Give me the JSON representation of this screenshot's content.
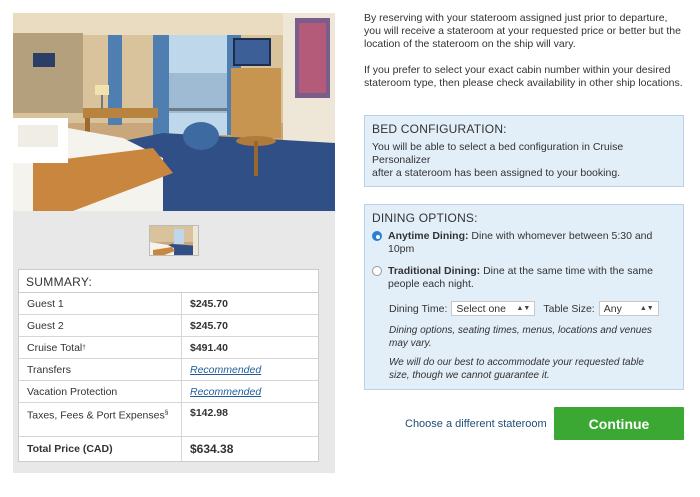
{
  "intro": {
    "paragraph1": "By reserving with your stateroom assigned just prior to departure, you will receive a stateroom at your requested price or better but the location of the stateroom on the ship will vary.",
    "paragraph2": "If you prefer to select your exact cabin number within your desired stateroom type, then please check availability in other ship locations."
  },
  "bed_config": {
    "title": "BED CONFIGURATION:",
    "line1": "You will be able to select a bed configuration in Cruise Personalizer",
    "line2": "after a stateroom has been assigned to your booking."
  },
  "dining": {
    "title": "DINING OPTIONS:",
    "anytime_label": "Anytime Dining:",
    "anytime_desc": "Dine with whomever between 5:30 and 10pm",
    "traditional_label": "Traditional Dining:",
    "traditional_desc": "Dine at the same time with the same people each night.",
    "dining_time_label": "Dining Time:",
    "dining_time_value": "Select one",
    "table_size_label": "Table Size:",
    "table_size_value": "Any",
    "note1": "Dining options, seating times, menus, locations and venues may vary.",
    "note2": "We will do our best to accommodate your requested table size, though we cannot guarantee it."
  },
  "summary": {
    "title": "SUMMARY:",
    "rows": [
      {
        "label": "Guest 1",
        "value": "$245.70"
      },
      {
        "label": "Guest 2",
        "value": "$245.70"
      },
      {
        "label": "Cruise Total",
        "sup": "†",
        "value": "$491.40"
      },
      {
        "label": "Transfers",
        "value": "Recommended"
      },
      {
        "label": "Vacation Protection",
        "value": "Recommended"
      },
      {
        "label": "Taxes, Fees & Port Expenses",
        "sup": "§",
        "value": "$142.98"
      },
      {
        "label": "Total Price (CAD)",
        "value": "$634.38"
      }
    ]
  },
  "actions": {
    "change_stateroom": "Choose a different stateroom",
    "continue": "Continue"
  },
  "colors": {
    "continue_green": "#3aa832",
    "info_box_bg": "#e2eef8",
    "link_blue": "#1f5c99"
  }
}
